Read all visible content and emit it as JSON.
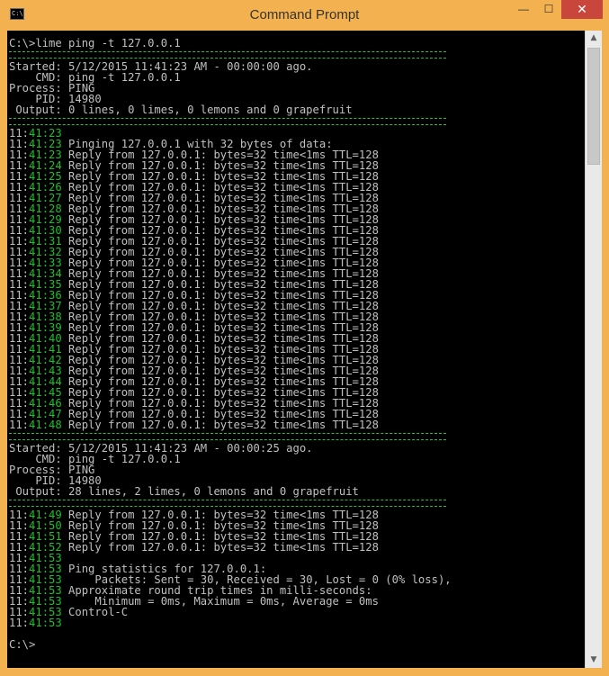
{
  "window": {
    "title": "Command Prompt",
    "icon_text": "C:\\",
    "minimize": "—",
    "maximize": "☐",
    "close": "✕"
  },
  "colors": {
    "chrome": "#f3b24f",
    "console_bg": "#000000",
    "text": "#c0c0c0",
    "green": "#1fbf2c",
    "close": "#c9463d"
  },
  "console": {
    "lines": [
      {
        "text": "C:\\>lime ping -t 127.0.0.1"
      },
      {
        "sep": true
      },
      {
        "text": "Started: 5/12/2015 11:41:23 AM - 00:00:00 ago."
      },
      {
        "text": "    CMD: ping -t 127.0.0.1"
      },
      {
        "text": "Process: PING"
      },
      {
        "text": "    PID: 14980"
      },
      {
        "text": " Output: 0 lines, 0 limes, 0 lemons and 0 grapefruit"
      },
      {
        "sep": true
      },
      {
        "time": "11:41:23",
        "text": ""
      },
      {
        "time": "11:41:23",
        "text": " Pinging 127.0.0.1 with 32 bytes of data:"
      },
      {
        "time": "11:41:23",
        "text": " Reply from 127.0.0.1: bytes=32 time<1ms TTL=128"
      },
      {
        "time": "11:41:24",
        "text": " Reply from 127.0.0.1: bytes=32 time<1ms TTL=128"
      },
      {
        "time": "11:41:25",
        "text": " Reply from 127.0.0.1: bytes=32 time<1ms TTL=128"
      },
      {
        "time": "11:41:26",
        "text": " Reply from 127.0.0.1: bytes=32 time<1ms TTL=128"
      },
      {
        "time": "11:41:27",
        "text": " Reply from 127.0.0.1: bytes=32 time<1ms TTL=128"
      },
      {
        "time": "11:41:28",
        "text": " Reply from 127.0.0.1: bytes=32 time<1ms TTL=128"
      },
      {
        "time": "11:41:29",
        "text": " Reply from 127.0.0.1: bytes=32 time<1ms TTL=128"
      },
      {
        "time": "11:41:30",
        "text": " Reply from 127.0.0.1: bytes=32 time<1ms TTL=128"
      },
      {
        "time": "11:41:31",
        "text": " Reply from 127.0.0.1: bytes=32 time<1ms TTL=128"
      },
      {
        "time": "11:41:32",
        "text": " Reply from 127.0.0.1: bytes=32 time<1ms TTL=128"
      },
      {
        "time": "11:41:33",
        "text": " Reply from 127.0.0.1: bytes=32 time<1ms TTL=128"
      },
      {
        "time": "11:41:34",
        "text": " Reply from 127.0.0.1: bytes=32 time<1ms TTL=128"
      },
      {
        "time": "11:41:35",
        "text": " Reply from 127.0.0.1: bytes=32 time<1ms TTL=128"
      },
      {
        "time": "11:41:36",
        "text": " Reply from 127.0.0.1: bytes=32 time<1ms TTL=128"
      },
      {
        "time": "11:41:37",
        "text": " Reply from 127.0.0.1: bytes=32 time<1ms TTL=128"
      },
      {
        "time": "11:41:38",
        "text": " Reply from 127.0.0.1: bytes=32 time<1ms TTL=128"
      },
      {
        "time": "11:41:39",
        "text": " Reply from 127.0.0.1: bytes=32 time<1ms TTL=128"
      },
      {
        "time": "11:41:40",
        "text": " Reply from 127.0.0.1: bytes=32 time<1ms TTL=128"
      },
      {
        "time": "11:41:41",
        "text": " Reply from 127.0.0.1: bytes=32 time<1ms TTL=128"
      },
      {
        "time": "11:41:42",
        "text": " Reply from 127.0.0.1: bytes=32 time<1ms TTL=128"
      },
      {
        "time": "11:41:43",
        "text": " Reply from 127.0.0.1: bytes=32 time<1ms TTL=128"
      },
      {
        "time": "11:41:44",
        "text": " Reply from 127.0.0.1: bytes=32 time<1ms TTL=128"
      },
      {
        "time": "11:41:45",
        "text": " Reply from 127.0.0.1: bytes=32 time<1ms TTL=128"
      },
      {
        "time": "11:41:46",
        "text": " Reply from 127.0.0.1: bytes=32 time<1ms TTL=128"
      },
      {
        "time": "11:41:47",
        "text": " Reply from 127.0.0.1: bytes=32 time<1ms TTL=128"
      },
      {
        "time": "11:41:48",
        "text": " Reply from 127.0.0.1: bytes=32 time<1ms TTL=128"
      },
      {
        "sep": true
      },
      {
        "text": "Started: 5/12/2015 11:41:23 AM - 00:00:25 ago."
      },
      {
        "text": "    CMD: ping -t 127.0.0.1"
      },
      {
        "text": "Process: PING"
      },
      {
        "text": "    PID: 14980"
      },
      {
        "text": " Output: 28 lines, 2 limes, 0 lemons and 0 grapefruit"
      },
      {
        "sep": true
      },
      {
        "time": "11:41:49",
        "text": " Reply from 127.0.0.1: bytes=32 time<1ms TTL=128"
      },
      {
        "time": "11:41:50",
        "text": " Reply from 127.0.0.1: bytes=32 time<1ms TTL=128"
      },
      {
        "time": "11:41:51",
        "text": " Reply from 127.0.0.1: bytes=32 time<1ms TTL=128"
      },
      {
        "time": "11:41:52",
        "text": " Reply from 127.0.0.1: bytes=32 time<1ms TTL=128"
      },
      {
        "time": "11:41:53",
        "text": ""
      },
      {
        "time": "11:41:53",
        "text": " Ping statistics for 127.0.0.1:"
      },
      {
        "time": "11:41:53",
        "text": "     Packets: Sent = 30, Received = 30, Lost = 0 (0% loss),"
      },
      {
        "time": "11:41:53",
        "text": " Approximate round trip times in milli-seconds:"
      },
      {
        "time": "11:41:53",
        "text": "     Minimum = 0ms, Maximum = 0ms, Average = 0ms"
      },
      {
        "time": "11:41:53",
        "text": " Control-C"
      },
      {
        "time": "11:41:53",
        "text": ""
      },
      {
        "text": ""
      },
      {
        "text": "C:\\>"
      }
    ]
  },
  "scrollbar": {
    "up": "▲",
    "down": "▼"
  }
}
